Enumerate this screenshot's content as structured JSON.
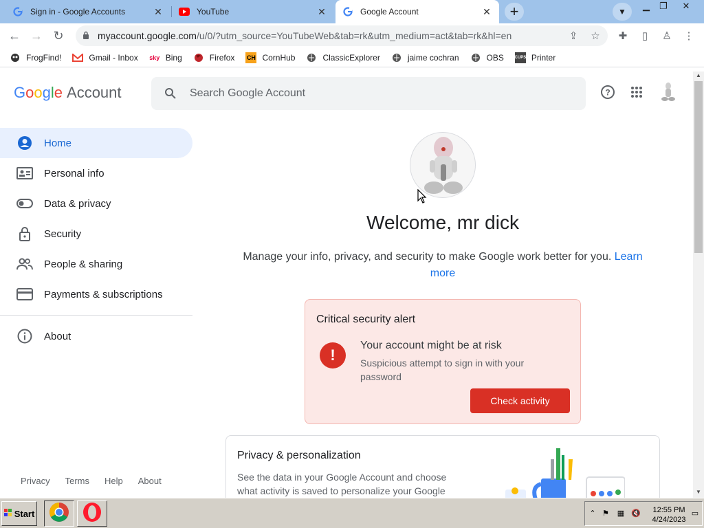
{
  "tabs": [
    {
      "title": "Sign in - Google Accounts",
      "icon": "google-g-icon",
      "active": false
    },
    {
      "title": "YouTube",
      "icon": "youtube-icon",
      "active": false
    },
    {
      "title": "Google Account",
      "icon": "google-g-icon",
      "active": true
    }
  ],
  "toolbar": {
    "url_host": "myaccount.google.com",
    "url_path": "/u/0/?utm_source=YouTubeWeb&tab=rk&utm_medium=act&tab=rk&hl=en"
  },
  "bookmarks": [
    {
      "label": "FrogFind!",
      "icon": "frog-icon"
    },
    {
      "label": "Gmail - Inbox",
      "icon": "gmail-icon"
    },
    {
      "label": "Bing",
      "icon": "sky-icon"
    },
    {
      "label": "Firefox",
      "icon": "firefox-icon"
    },
    {
      "label": "CornHub",
      "icon": "ch-icon"
    },
    {
      "label": "ClassicExplorer",
      "icon": "globe-icon"
    },
    {
      "label": "jaime cochran",
      "icon": "globe-icon"
    },
    {
      "label": "OBS",
      "icon": "globe-icon"
    },
    {
      "label": "Printer",
      "icon": "cups-icon"
    }
  ],
  "header": {
    "logo_google": "Google",
    "logo_account": "Account",
    "search_placeholder": "Search Google Account"
  },
  "nav": {
    "items": [
      {
        "label": "Home",
        "icon": "account-circle-icon",
        "active": true
      },
      {
        "label": "Personal info",
        "icon": "id-card-icon"
      },
      {
        "label": "Data & privacy",
        "icon": "toggle-icon"
      },
      {
        "label": "Security",
        "icon": "lock-icon"
      },
      {
        "label": "People & sharing",
        "icon": "people-icon"
      },
      {
        "label": "Payments & subscriptions",
        "icon": "credit-card-icon"
      }
    ],
    "about": "About"
  },
  "footer": [
    "Privacy",
    "Terms",
    "Help",
    "About"
  ],
  "main": {
    "welcome": "Welcome, mr dick",
    "subtext": "Manage your info, privacy, and security to make Google work better for you.",
    "learn_more": "Learn more"
  },
  "alert": {
    "title": "Critical security alert",
    "heading": "Your account might be at risk",
    "body": "Suspicious attempt to sign in with your password",
    "button": "Check activity"
  },
  "card": {
    "title": "Privacy & personalization",
    "body": "See the data in your Google Account and choose what activity is saved to personalize your Google"
  },
  "taskbar": {
    "start": "Start",
    "time": "12:55 PM",
    "date": "4/24/2023"
  },
  "colors": {
    "tabstrip": "#9fc3ea",
    "nav_active_bg": "#e8f0fe",
    "nav_active_text": "#1967d2",
    "alert_bg": "#fce8e6",
    "alert_red": "#d93025",
    "link": "#1a73e8"
  }
}
